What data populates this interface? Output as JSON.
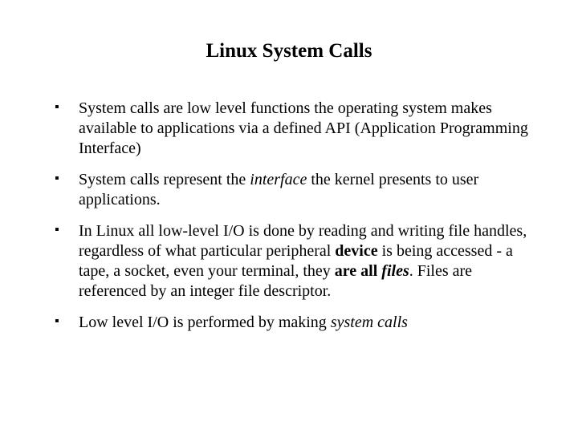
{
  "title": "Linux System Calls",
  "bullets": {
    "b1": {
      "text": "System calls are low level functions the operating system makes available to applications via a defined API (Application Programming Interface)"
    },
    "b2": {
      "pre": "System calls represent the ",
      "em": "interface",
      "post": " the kernel presents to user applications."
    },
    "b3": {
      "pre": " In Linux all low-level I/O is done by reading and writing file handles, regardless of what particular peripheral ",
      "strong1": "device",
      "mid1": " is being accessed - a tape, a socket, even your terminal, they ",
      "strong2": "are all ",
      "em": "files",
      "post": ". Files are referenced by an integer file descriptor."
    },
    "b4": {
      "pre": "Low level I/O is performed by making ",
      "em": "system calls"
    }
  }
}
